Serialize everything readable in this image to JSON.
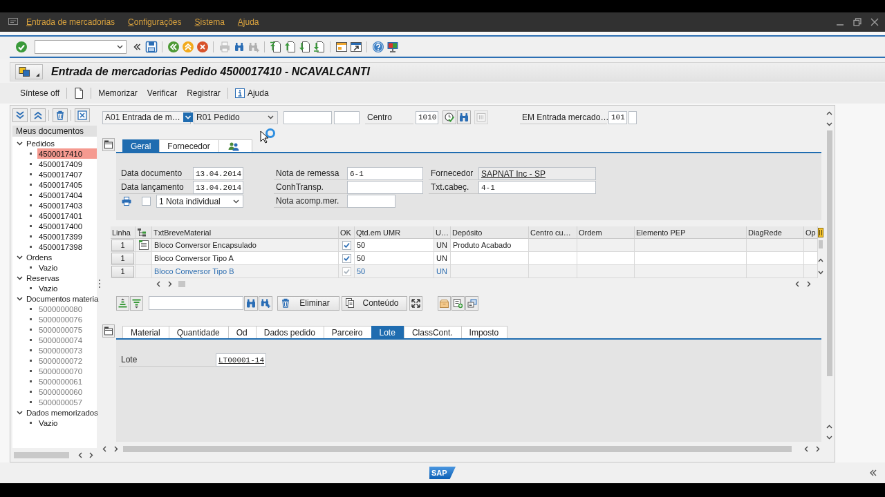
{
  "menu_bar": {
    "items": [
      "Entrada de mercadorias",
      "Configurações",
      "Sistema",
      "Ajuda"
    ]
  },
  "toolbar": {
    "groups": [
      [
        {
          "kind": "enter",
          "disabled": false
        },
        {
          "kind": "command-field",
          "disabled": false
        },
        {
          "kind": "collapse",
          "disabled": false
        },
        {
          "kind": "save",
          "disabled": false
        }
      ],
      [
        {
          "kind": "back",
          "disabled": false
        },
        {
          "kind": "exit",
          "disabled": false
        },
        {
          "kind": "cancel",
          "disabled": false
        }
      ],
      [
        {
          "kind": "print",
          "disabled": true
        },
        {
          "kind": "find",
          "disabled": false
        },
        {
          "kind": "find-next",
          "disabled": true
        }
      ],
      [
        {
          "kind": "first-page",
          "disabled": false
        },
        {
          "kind": "previous-page",
          "disabled": false
        },
        {
          "kind": "next-page",
          "disabled": false
        },
        {
          "kind": "last-page",
          "disabled": false
        }
      ],
      [
        {
          "kind": "new-session",
          "disabled": false
        },
        {
          "kind": "shortcut",
          "disabled": false
        }
      ],
      [
        {
          "kind": "help",
          "disabled": false
        },
        {
          "kind": "layout",
          "disabled": false
        }
      ]
    ]
  },
  "title": "Entrada de mercadorias Pedido 4500017410 - NCAVALCANTI",
  "app_toolbar": {
    "groups": [
      [
        {
          "kind": "text",
          "label": "Síntese off"
        }
      ],
      [
        {
          "kind": "new-document"
        }
      ],
      [
        {
          "kind": "text",
          "label": "Memorizar"
        },
        {
          "kind": "text",
          "label": "Verificar"
        },
        {
          "kind": "text",
          "label": "Registrar"
        }
      ],
      [
        {
          "kind": "info",
          "label": "Ajuda"
        }
      ]
    ]
  },
  "sidebar": {
    "toolbar": [
      [
        {
          "kind": "expand-all"
        },
        {
          "kind": "collapse-all"
        }
      ],
      [
        {
          "kind": "delete"
        }
      ],
      [
        {
          "kind": "close"
        }
      ]
    ],
    "header": "Meus documentos",
    "tree": [
      {
        "label": "Pedidos",
        "expanded": true,
        "selected": false,
        "children": [
          {
            "label": "4500017410",
            "selected": true,
            "disabled": false
          },
          {
            "label": "4500017409",
            "selected": false,
            "disabled": false
          },
          {
            "label": "4500017407",
            "selected": false,
            "disabled": false
          },
          {
            "label": "4500017405",
            "selected": false,
            "disabled": false
          },
          {
            "label": "4500017404",
            "selected": false,
            "disabled": false
          },
          {
            "label": "4500017403",
            "selected": false,
            "disabled": false
          },
          {
            "label": "4500017401",
            "selected": false,
            "disabled": false
          },
          {
            "label": "4500017400",
            "selected": false,
            "disabled": false
          },
          {
            "label": "4500017399",
            "selected": false,
            "disabled": false
          },
          {
            "label": "4500017398",
            "selected": false,
            "disabled": false
          }
        ]
      },
      {
        "label": "Ordens",
        "expanded": true,
        "selected": false,
        "children": [
          {
            "label": "Vazio",
            "selected": false,
            "disabled": false
          }
        ]
      },
      {
        "label": "Reservas",
        "expanded": true,
        "selected": false,
        "children": [
          {
            "label": "Vazio",
            "selected": false,
            "disabled": false
          }
        ]
      },
      {
        "label": "Documentos materia",
        "expanded": true,
        "selected": false,
        "children": [
          {
            "label": "5000000080",
            "selected": false,
            "disabled": true
          },
          {
            "label": "5000000076",
            "selected": false,
            "disabled": true
          },
          {
            "label": "5000000075",
            "selected": false,
            "disabled": true
          },
          {
            "label": "5000000074",
            "selected": false,
            "disabled": true
          },
          {
            "label": "5000000073",
            "selected": false,
            "disabled": true
          },
          {
            "label": "5000000072",
            "selected": false,
            "disabled": true
          },
          {
            "label": "5000000070",
            "selected": false,
            "disabled": true
          },
          {
            "label": "5000000061",
            "selected": false,
            "disabled": true
          },
          {
            "label": "5000000060",
            "selected": false,
            "disabled": true
          },
          {
            "label": "5000000057",
            "selected": false,
            "disabled": true
          }
        ]
      },
      {
        "label": "Dados memorizados",
        "expanded": true,
        "selected": false,
        "children": [
          {
            "label": "Vazio",
            "selected": false,
            "disabled": false
          }
        ]
      }
    ]
  },
  "selection": {
    "transaction": "A01 Entrada de m…",
    "reference": "R01 Pedido",
    "plant": {
      "label": "Centro",
      "value": "1010"
    },
    "tools": [
      {
        "kind": "clock-check",
        "disabled": false
      },
      {
        "kind": "find",
        "disabled": false
      },
      {
        "kind": "columns",
        "disabled": true
      }
    ],
    "movement_type": {
      "label": "EM Entrada mercado…",
      "value": "101"
    }
  },
  "header_tabs": [
    {
      "kind": "text",
      "label": "Geral",
      "selected": true
    },
    {
      "kind": "text",
      "label": "Fornecedor",
      "selected": false
    },
    {
      "kind": "icon",
      "selected": false
    }
  ],
  "header_fields": [
    [
      {
        "kind": "input",
        "label": "Data documento",
        "value": "13.04.2014"
      },
      {
        "kind": "input",
        "label": "Data lançamento",
        "value": "13.04.2014"
      }
    ],
    [
      {
        "kind": "input",
        "label": "Nota de remessa",
        "value": "6-1"
      },
      {
        "kind": "input",
        "label": "ConhTransp."
      },
      {
        "kind": "input",
        "label": "Nota acomp.mer."
      }
    ],
    [
      {
        "kind": "display",
        "label": "Fornecedor",
        "value": "SAPNAT Inc - SP"
      },
      {
        "kind": "input",
        "label": "Txt.cabeç.",
        "value": "4-1"
      }
    ]
  ],
  "print_options": {
    "checked": false,
    "value": "1 Nota individual"
  },
  "items_table": {
    "columns": [
      {
        "kind": "button",
        "label": "Linha"
      },
      {
        "kind": "icon"
      },
      {
        "kind": "text",
        "label": "TxtBreveMaterial"
      },
      {
        "kind": "check",
        "label": "OK"
      },
      {
        "kind": "input",
        "label": "Qtd.em UMR"
      },
      {
        "kind": "text",
        "label": "U…"
      },
      {
        "kind": "input",
        "label": "Depósito"
      },
      {
        "kind": "text",
        "label": "Centro cu…"
      },
      {
        "kind": "text",
        "label": "Ordem"
      },
      {
        "kind": "text",
        "label": "Elemento PEP"
      },
      {
        "kind": "text",
        "label": "DiagRede"
      },
      {
        "kind": "text",
        "label": "Op"
      }
    ],
    "rows": [
      {
        "kind": "header",
        "disabled": false,
        "line": "1",
        "material": "Bloco Conversor Encapsulado",
        "ok": true,
        "quantity": "50",
        "unit": "UN",
        "storage_location": "Produto Acabado"
      },
      {
        "kind": "item",
        "disabled": false,
        "line": "1",
        "material": "Bloco Conversor Tipo A",
        "ok": true,
        "quantity": "50",
        "unit": "UN"
      },
      {
        "kind": "item",
        "disabled": true,
        "line": "1",
        "material": "Bloco Conversor Tipo B",
        "ok": true,
        "quantity": "50",
        "unit": "UN"
      }
    ]
  },
  "item_toolbar": {
    "items": [
      {
        "kind": "expand"
      },
      {
        "kind": "collapse"
      },
      {
        "kind": "search-field"
      },
      {
        "kind": "find"
      },
      {
        "kind": "find-next"
      },
      {
        "kind": "delete",
        "label": "Eliminar"
      },
      {
        "kind": "copy",
        "label": "Conteúdo"
      },
      {
        "kind": "fullscreen"
      },
      {
        "kind": "box"
      },
      {
        "kind": "add-row"
      },
      {
        "kind": "transfer"
      }
    ]
  },
  "detail_tabs": [
    {
      "label": "Material",
      "selected": false
    },
    {
      "label": "Quantidade",
      "selected": false
    },
    {
      "label": "Od",
      "selected": false
    },
    {
      "label": "Dados pedido",
      "selected": false
    },
    {
      "label": "Parceiro",
      "selected": false
    },
    {
      "label": "Lote",
      "selected": true
    },
    {
      "label": "ClassCont.",
      "selected": false
    },
    {
      "label": "Imposto",
      "selected": false
    }
  ],
  "detail_fields": [
    {
      "kind": "hotspot",
      "label": "Lote",
      "value": "LT00001-14"
    }
  ],
  "status_bar": {
    "logo": "SAP"
  }
}
